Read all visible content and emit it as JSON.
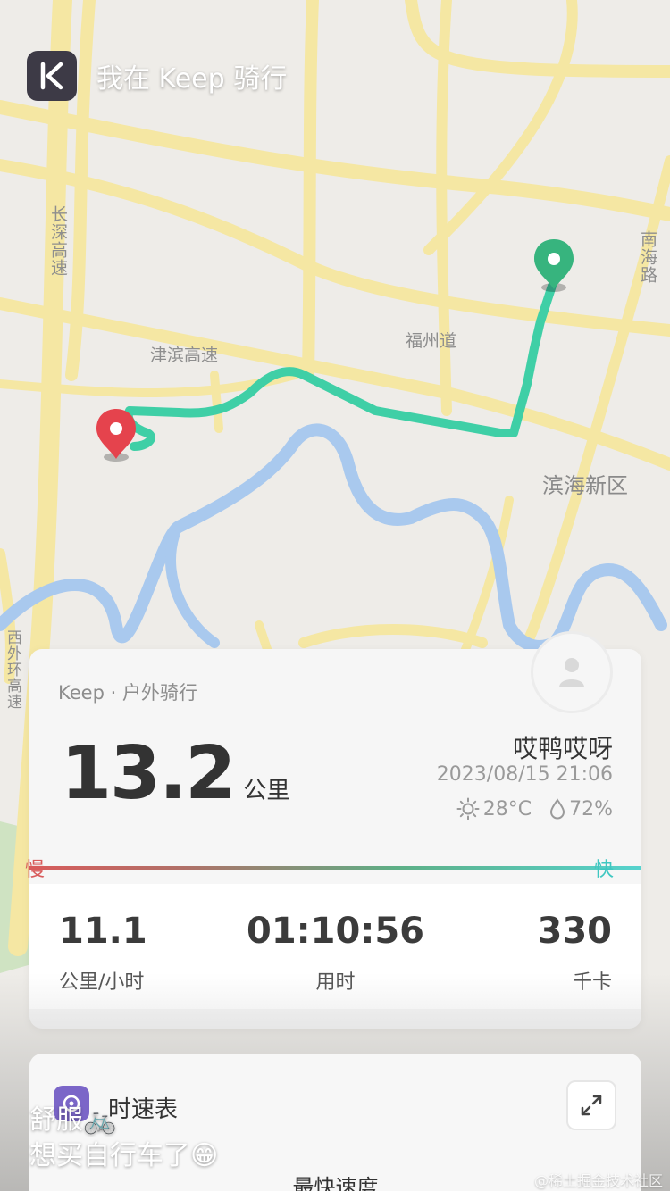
{
  "header": {
    "app_name": "我在 Keep 骑行"
  },
  "map": {
    "labels": {
      "changshen": "长深高速",
      "jinbin": "津滨高速",
      "fuzhou": "福州道",
      "nanhai": "南海路",
      "binhai": "滨海新区",
      "xiwaihuan": "西外环高速"
    },
    "colors": {
      "route": "#3fcfa6",
      "water": "#a9c9ee",
      "road": "#f5e7a3",
      "start_marker": "#37b47e",
      "end_marker": "#e5434d"
    }
  },
  "summary_card": {
    "sport_type": "Keep · 户外骑行",
    "distance": "13.2",
    "distance_unit": "公里",
    "username": "哎鸭哎呀",
    "datetime": "2023/08/15 21:06",
    "temperature": "28°C",
    "humidity": "72%"
  },
  "speed_legend": {
    "slow": "慢",
    "fast": "快"
  },
  "stats": [
    {
      "value": "11.1",
      "label": "公里/小时"
    },
    {
      "value": "01:10:56",
      "label": "用时"
    },
    {
      "value": "330",
      "label": "千卡"
    }
  ],
  "speed_card": {
    "title": "时速表",
    "max_speed_label": "最快速度"
  },
  "caption": {
    "line1": "舒服🚲",
    "line2": "想买自行车了😁"
  },
  "watermark": "@稀土掘金技术社区"
}
